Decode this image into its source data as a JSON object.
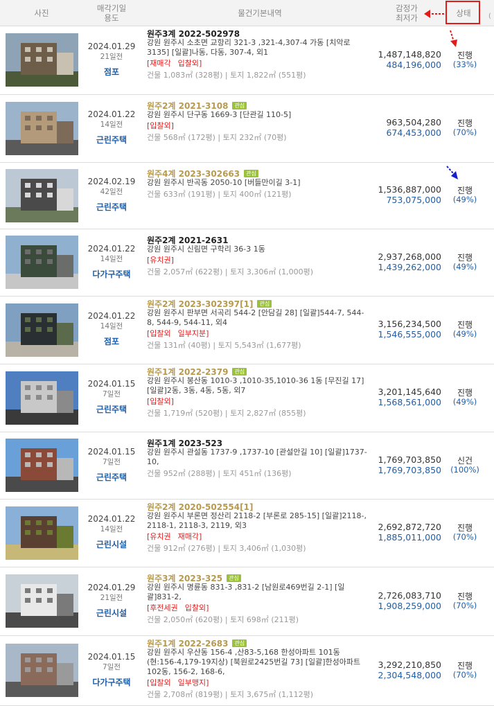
{
  "header": {
    "photo": "사진",
    "date_usage_1": "매각기일",
    "date_usage_2": "용도",
    "info": "물건기본내역",
    "appraisal_1": "감정가",
    "appraisal_2": "최저가",
    "status": "상태",
    "extra": "("
  },
  "colors": {
    "red": "#e21b1b",
    "blue": "#1f5ea8",
    "gold": "#b89a4e",
    "badge": "#9bc13c"
  },
  "rows": [
    {
      "date": "2024.01.29",
      "days": "21일전",
      "usage": "점포",
      "case": "원주3계 2022-502978",
      "case_style": "plain",
      "badge": "",
      "address": "강원 원주시 소초면 교항리 321-3 ,321-4,307-4 가동 [치악로 3135] [일괄]나동, 다동, 307-4, 외1",
      "flags": [
        "[재매각",
        "입찰외]"
      ],
      "size": "건물 1,083㎡ (328평)  |  토지 1,822㎡ (551평)",
      "appraisal": "1,487,148,820",
      "minimum": "484,196,000",
      "status": "진행",
      "pct": "(33%)"
    },
    {
      "date": "2024.01.22",
      "days": "14일전",
      "usage": "근린주택",
      "case": "원주2계 2021-3108",
      "case_style": "gold",
      "badge": "관심",
      "address": "강원 원주시 단구동 1669-3 [단관길 110-5]",
      "flags": [
        "[입찰외]"
      ],
      "size": "건물 568㎡ (172평)  |  토지 232㎡ (70평)",
      "appraisal": "963,504,280",
      "minimum": "674,453,000",
      "status": "진행",
      "pct": "(70%)"
    },
    {
      "date": "2024.02.19",
      "days": "42일전",
      "usage": "근린주택",
      "case": "원주4계 2023-302663",
      "case_style": "gold",
      "badge": "관심",
      "address": "강원 원주시 반곡동 2050-10 [버들만이길 3-1]",
      "flags": [],
      "size": "건물 633㎡ (191평)  |  토지 400㎡ (121평)",
      "appraisal": "1,536,887,000",
      "minimum": "753,075,000",
      "status": "진행",
      "pct": "(49%)"
    },
    {
      "date": "2024.01.22",
      "days": "14일전",
      "usage": "다가구주택",
      "case": "원주2계 2021-2631",
      "case_style": "plain",
      "badge": "",
      "address": "강원 원주시 신림면 구학리 36-3 1동",
      "flags": [
        "[유치권]"
      ],
      "size": "건물 2,057㎡ (622평)  |  토지 3,306㎡ (1,000평)",
      "appraisal": "2,937,268,000",
      "minimum": "1,439,262,000",
      "status": "진행",
      "pct": "(49%)"
    },
    {
      "date": "2024.01.22",
      "days": "14일전",
      "usage": "점포",
      "case": "원주2계 2023-302397[1]",
      "case_style": "gold",
      "badge": "관심",
      "address": "강원 원주시 판부면 서곡리 544-2 [안담길 28]  [일괄]544-7, 544-8, 544-9, 544-11, 외4",
      "flags": [
        "[입찰외",
        "일부지분]"
      ],
      "size": "건물 131㎡ (40평)  |  토지 5,543㎡ (1,677평)",
      "appraisal": "3,156,234,500",
      "minimum": "1,546,555,000",
      "status": "진행",
      "pct": "(49%)"
    },
    {
      "date": "2024.01.15",
      "days": "7일전",
      "usage": "근린주택",
      "case": "원주1계 2022-2379",
      "case_style": "gold",
      "badge": "관심",
      "address": "강원 원주시 봉산동 1010-3 ,1010-35,1010-36 1동 [무진길 17]  [일괄]2동, 3동, 4동, 5동, 외7",
      "flags": [
        "[입찰외]"
      ],
      "size": "건물 1,719㎡ (520평)  |  토지 2,827㎡ (855평)",
      "appraisal": "3,201,145,640",
      "minimum": "1,568,561,000",
      "status": "진행",
      "pct": "(49%)"
    },
    {
      "date": "2024.01.15",
      "days": "7일전",
      "usage": "근린주택",
      "case": "원주1계 2023-523",
      "case_style": "plain",
      "badge": "",
      "address": "강원 원주시 관설동 1737-9 ,1737-10 [관설안길 10]  [일괄]1737-10,",
      "flags": [],
      "size": "건물 952㎡ (288평)  |  토지 451㎡ (136평)",
      "appraisal": "1,769,703,850",
      "minimum": "1,769,703,850",
      "status": "신건",
      "pct": "(100%)"
    },
    {
      "date": "2024.01.22",
      "days": "14일전",
      "usage": "근린시설",
      "case": "원주2계 2020-502554[1]",
      "case_style": "gold",
      "badge": "",
      "address": "강원 원주시 부론면 정산리 2118-2 [부론로 285-15]  [일괄]2118-, 2118-1, 2118-3, 2119, 외3",
      "flags": [
        "[유치권",
        "재매각]"
      ],
      "size": "건물 912㎡ (276평)  |  토지 3,406㎡ (1,030평)",
      "appraisal": "2,692,872,720",
      "minimum": "1,885,011,000",
      "status": "진행",
      "pct": "(70%)"
    },
    {
      "date": "2024.01.29",
      "days": "21일전",
      "usage": "근린시설",
      "case": "원주3계 2023-325",
      "case_style": "gold",
      "badge": "관심",
      "address": "강원 원주시 명륜동 831-3 ,831-2 [남원로469번길 2-1]  [일괄]831-2,",
      "flags": [
        "[후전세권",
        "입찰외]"
      ],
      "size": "건물 2,050㎡ (620평)  |  토지 698㎡ (211평)",
      "appraisal": "2,726,083,710",
      "minimum": "1,908,259,000",
      "status": "진행",
      "pct": "(70%)"
    },
    {
      "date": "2024.01.15",
      "days": "7일전",
      "usage": "다가구주택",
      "case": "원주1계 2022-2683",
      "case_style": "gold",
      "badge": "관심",
      "address": "강원 원주시 우산동 156-4 ,산83-5,168 한성아파트 101동 (현:156-4,179-19지상) [북원로2425번길 73]  [일괄]한성아파트 102동, 156-2, 168-6,",
      "flags": [
        "[입찰외",
        "일부맹지]"
      ],
      "size": "건물 2,708㎡ (819평)  |  토지 3,675㎡ (1,112평)",
      "appraisal": "3,292,210,850",
      "minimum": "2,304,548,000",
      "status": "진행",
      "pct": "(70%)"
    }
  ]
}
